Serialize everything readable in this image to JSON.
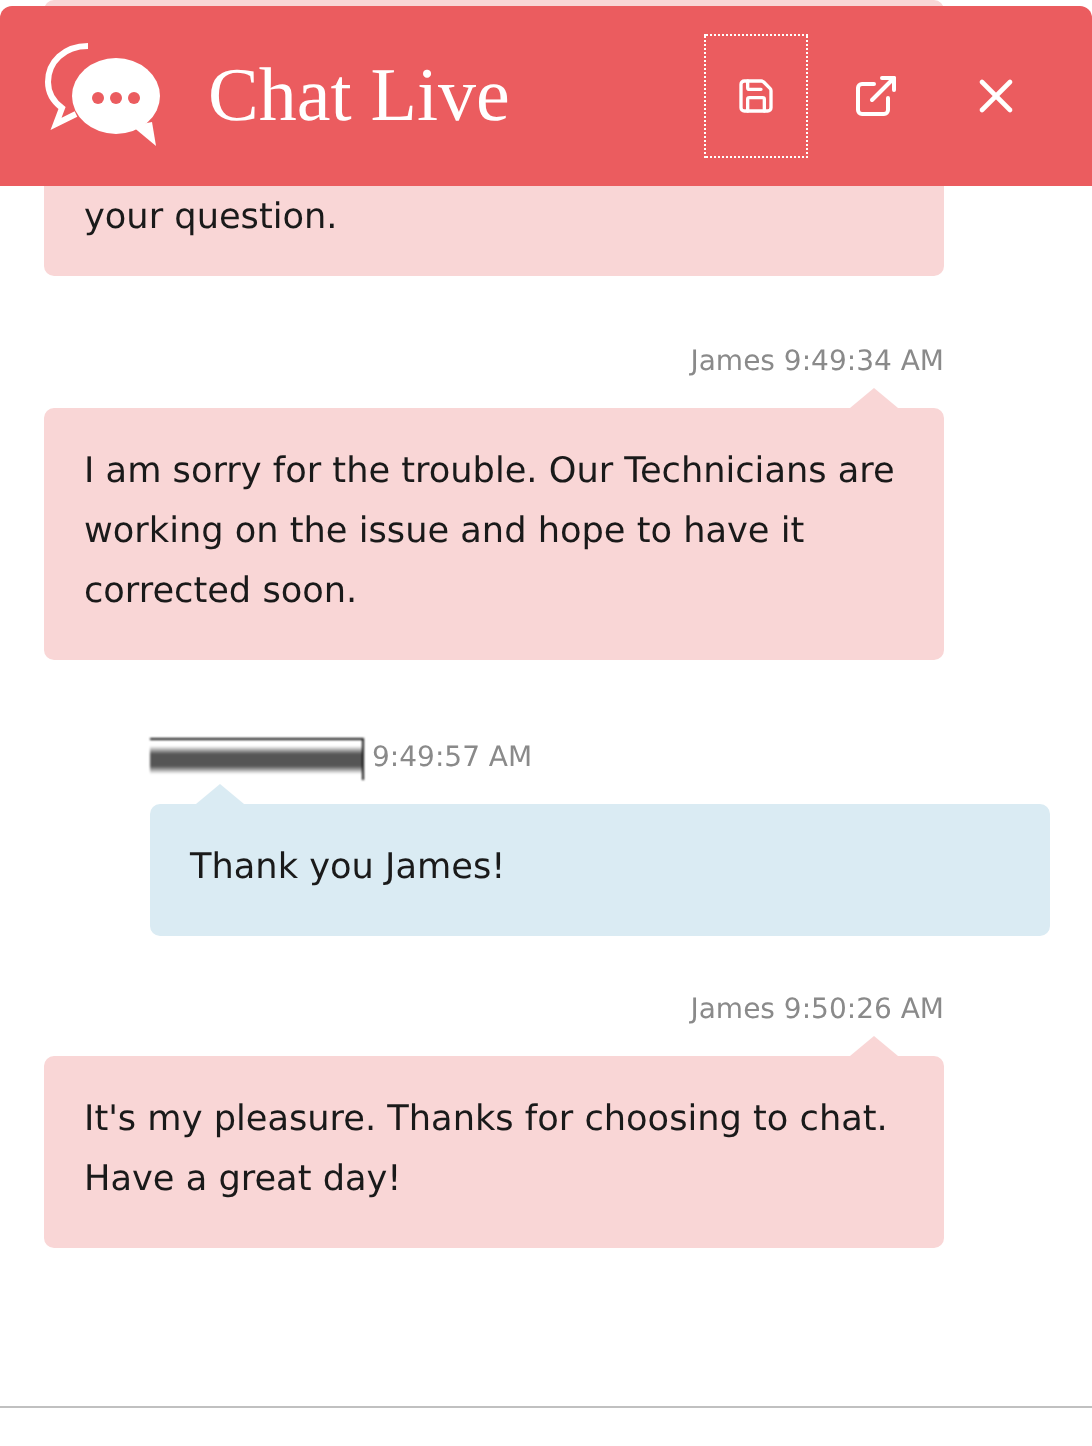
{
  "header": {
    "title": "Chat Live",
    "buttons": [
      {
        "kind": "save",
        "focused": true
      },
      {
        "kind": "popout",
        "focused": false
      },
      {
        "kind": "close",
        "focused": false
      }
    ]
  },
  "messages": [
    {
      "kind": "agent",
      "text": "your question."
    },
    {
      "kind": "agent",
      "sender": "James",
      "time": "9:49:34 AM",
      "text": "I am sorry for the trouble. Our Technicians are working on the issue and hope to have it corrected soon."
    },
    {
      "kind": "visitor",
      "time": "9:49:57 AM",
      "text": "Thank you James!"
    },
    {
      "kind": "agent",
      "sender": "James",
      "time": "9:50:26 AM",
      "text": "It's my pleasure. Thanks for choosing to chat. Have a great day!"
    }
  ]
}
